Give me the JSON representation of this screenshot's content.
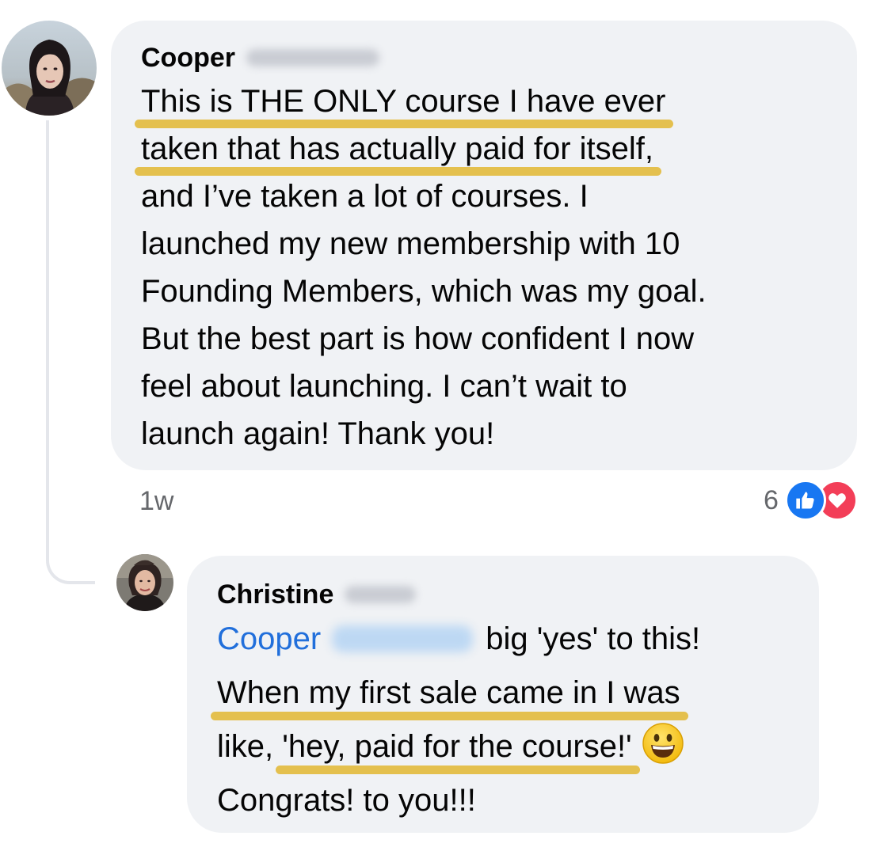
{
  "comment": {
    "author_first_name": "Cooper",
    "body_lines": [
      "This is THE ONLY course I have ever",
      "taken that has actually paid for itself,",
      "and I’ve taken a lot of courses. I",
      "launched my new membership with 10",
      "Founding Members, which was my goal.",
      "But the best part is how confident I now",
      "feel about launching. I can’t wait to",
      "launch again! Thank you!"
    ],
    "timestamp": "1w",
    "reaction_count": "6",
    "reaction_icons": [
      "like-icon",
      "love-icon"
    ]
  },
  "reply": {
    "author_first_name": "Christine",
    "mention_first_name": "Cooper",
    "line1_after_mention": "big 'yes' to this!",
    "line2": "When my first sale came in I was",
    "line3_prefix": "like, ",
    "line3_highlight": "'hey, paid for the course!'",
    "line3_emoji": "grinning-face-emoji",
    "line4": "Congrats! to you!!!"
  },
  "colors": {
    "bubble_bg": "#f0f2f5",
    "highlight": "#e4c04e",
    "mention": "#216fdb",
    "meta_text": "#65676b",
    "like": "#1877f2",
    "love": "#f33e58"
  }
}
